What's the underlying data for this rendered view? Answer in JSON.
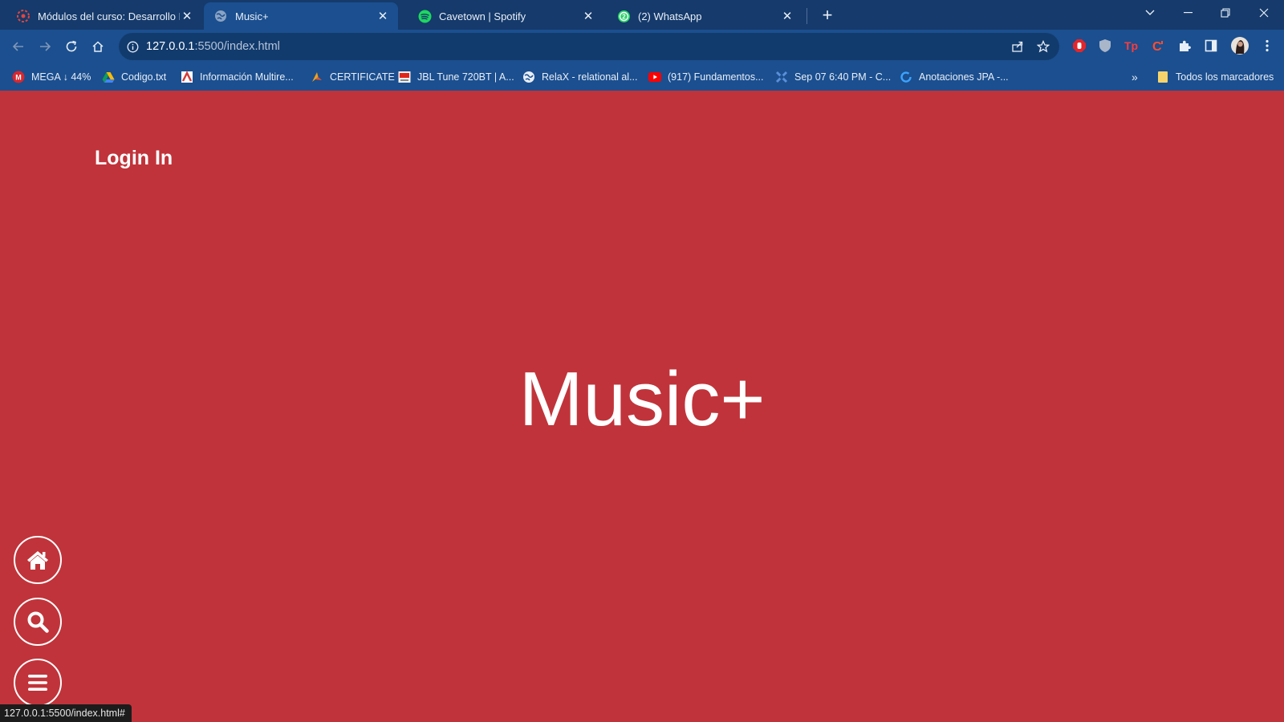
{
  "browser": {
    "tabs": [
      {
        "title": "Módulos del curso: Desarrollo B",
        "favicon": "course-icon"
      },
      {
        "title": "Music+",
        "favicon": "globe-icon",
        "active": true
      },
      {
        "title": "Cavetown | Spotify",
        "favicon": "spotify-icon"
      },
      {
        "title": "(2) WhatsApp",
        "favicon": "whatsapp-icon"
      }
    ],
    "address": {
      "host": "127.0.0.1",
      "rest": ":5500/index.html"
    },
    "bookmarks": [
      {
        "label": "MEGA ↓ 44%",
        "icon": "mega-icon"
      },
      {
        "label": "Codigo.txt",
        "icon": "drive-icon"
      },
      {
        "label": "Información Multire...",
        "icon": "bookmark-page-icon"
      },
      {
        "label": "CERTIFICATE",
        "icon": "certificate-icon"
      },
      {
        "label": "JBL Tune 720BT | A...",
        "icon": "jbl-icon"
      },
      {
        "label": "RelaX - relational al...",
        "icon": "globe-icon"
      },
      {
        "label": "(917) Fundamentos...",
        "icon": "youtube-icon"
      },
      {
        "label": "Sep 07 6:40 PM - C...",
        "icon": "meeting-icon"
      },
      {
        "label": "Anotaciones JPA -...",
        "icon": "sync-icon"
      }
    ],
    "bookmarks_overflow": "»",
    "all_bookmarks": "Todos los marcadores",
    "status_url": "127.0.0.1:5500/index.html#"
  },
  "page": {
    "login_label": "Login In",
    "hero_title": "Music+",
    "fab_buttons": [
      {
        "name": "home",
        "icon": "home-icon"
      },
      {
        "name": "search",
        "icon": "search-icon"
      },
      {
        "name": "menu",
        "icon": "menu-icon"
      }
    ]
  },
  "colors": {
    "page_background": "#c1333a",
    "chrome_background": "#1b4f8f",
    "tabstrip_background": "#153a6b",
    "text_on_page": "#ffffff"
  }
}
